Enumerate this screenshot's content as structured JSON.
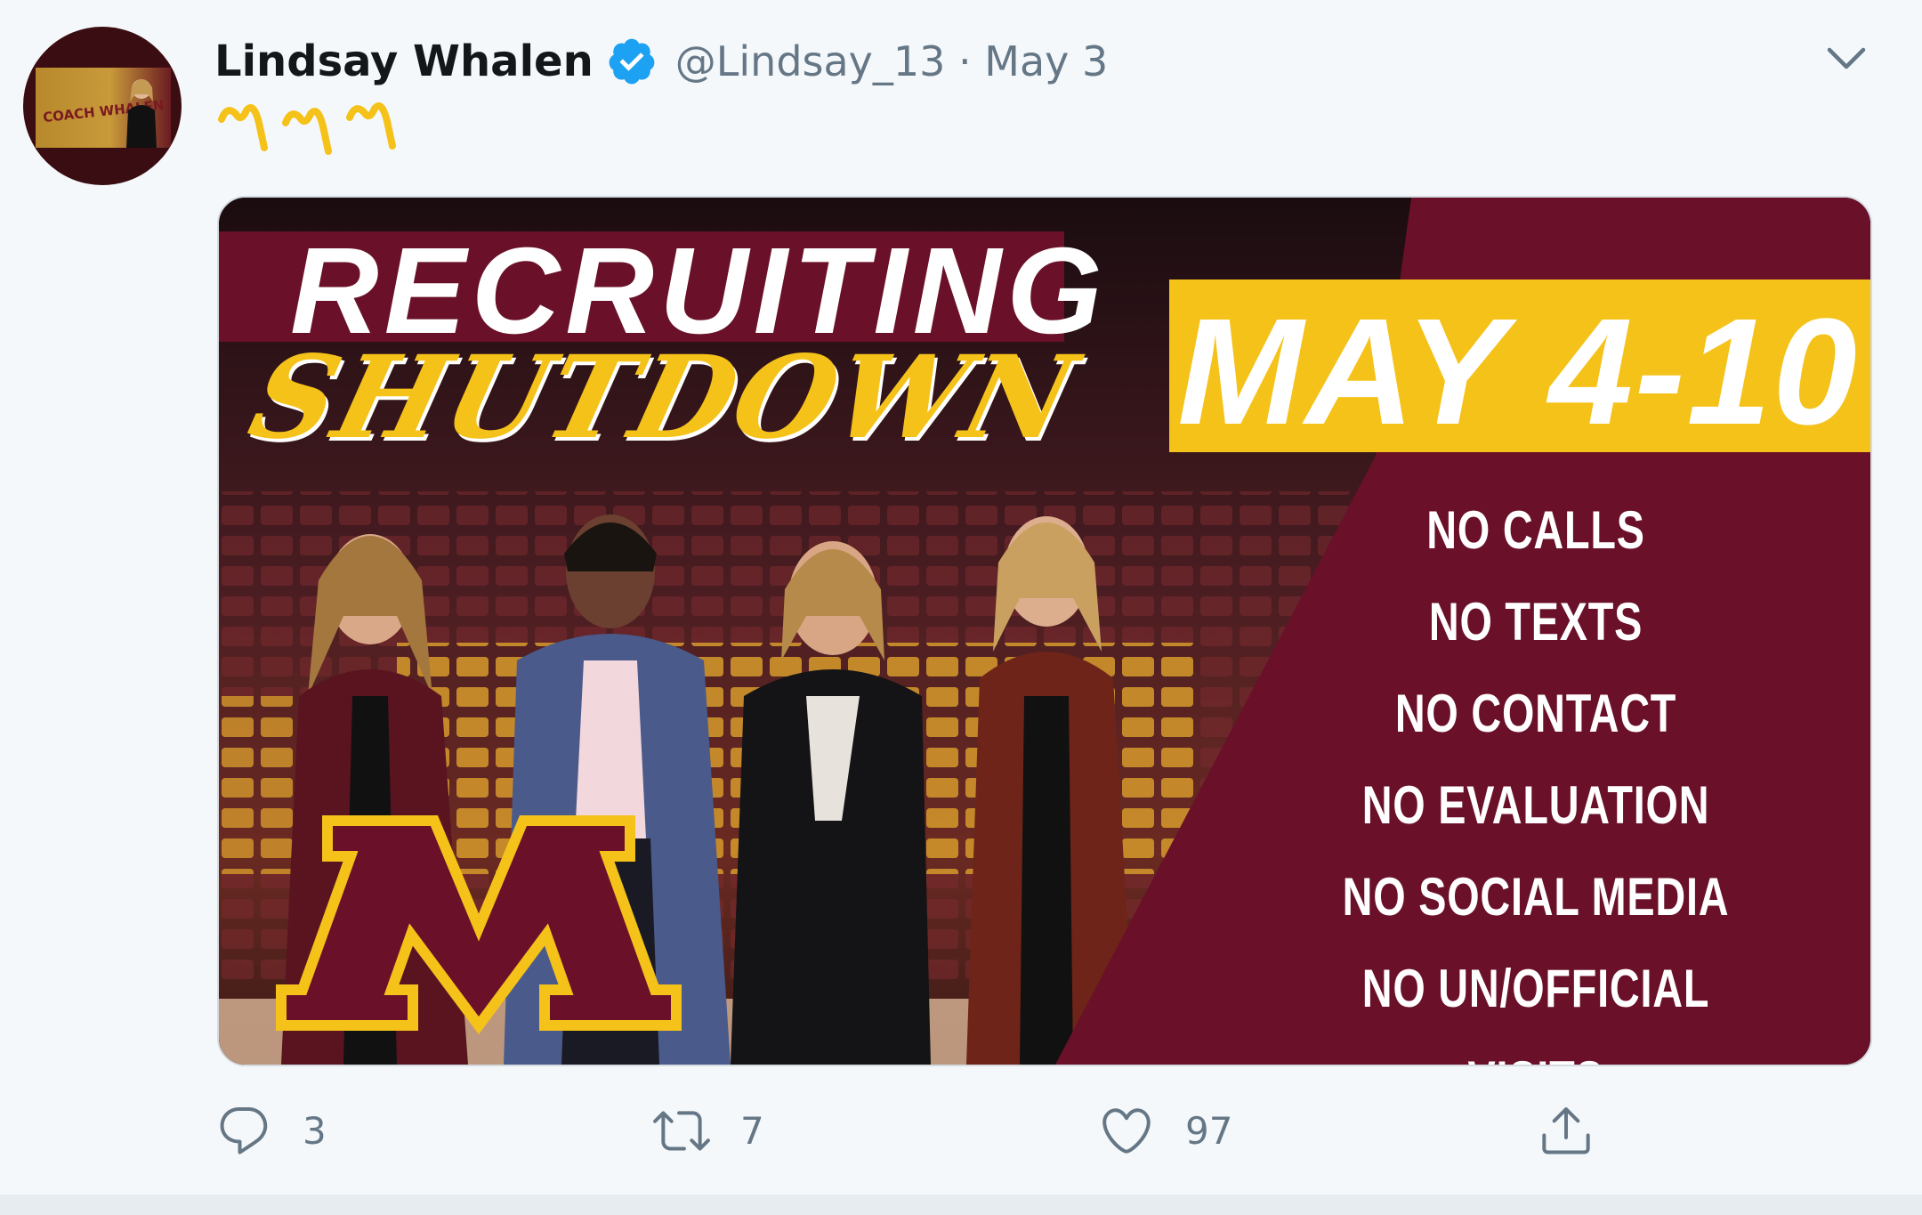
{
  "tweet": {
    "display_name": "Lindsay Whalen",
    "verified": true,
    "handle_and_date": "@Lindsay_13 · May 3",
    "text_icon": "gopher-hands-emoji-x3",
    "avatar_text": "COACH WHALEN"
  },
  "media": {
    "title_line1": "RECRUITING",
    "title_line2": "SHUTDOWN",
    "dates": "MAY 4-10",
    "rules": [
      "NO CALLS",
      "NO TEXTS",
      "NO CONTACT",
      "NO EVALUATION",
      "NO SOCIAL MEDIA",
      "NO UN/OFFICIAL VISITS"
    ],
    "logo": "minnesota-m-logo",
    "colors": {
      "maroon": "#6a1029",
      "gold": "#f5c21a"
    }
  },
  "actions": {
    "reply_count": "3",
    "retweet_count": "7",
    "like_count": "97"
  },
  "colors": {
    "background": "#f5f8fa",
    "text_primary": "#14171a",
    "text_secondary": "#657786",
    "verified_blue": "#1da1f2"
  }
}
